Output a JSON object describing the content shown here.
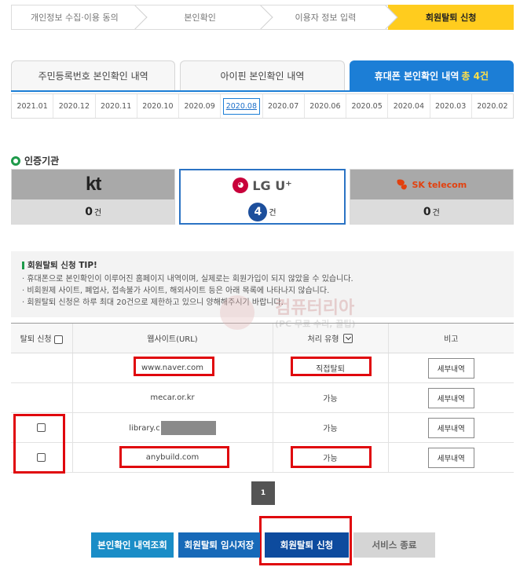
{
  "steps": [
    "개인정보 수집·이용 동의",
    "본인확인",
    "이용자 정보 입력",
    "회원탈퇴 신청"
  ],
  "tabs": [
    {
      "label": "주민등록번호 본인확인 내역",
      "count": ""
    },
    {
      "label": "아이핀 본인확인 내역",
      "count": ""
    },
    {
      "label": "휴대폰 본인확인 내역",
      "count": "총 4건"
    }
  ],
  "months": [
    "2021.01",
    "2020.12",
    "2020.11",
    "2020.10",
    "2020.09",
    "2020.08",
    "2020.07",
    "2020.06",
    "2020.05",
    "2020.04",
    "2020.03",
    "2020.02"
  ],
  "active_month": "2020.08",
  "agency": {
    "title": "인증기관",
    "carriers": [
      {
        "logo": "kt",
        "count": "0",
        "unit": "건"
      },
      {
        "logo": "LG U⁺",
        "count": "4",
        "unit": "건"
      },
      {
        "logo": "SK telecom",
        "count": "0",
        "unit": "건"
      }
    ]
  },
  "tip": {
    "title": "회원탈퇴 신청 TIP!",
    "lines": [
      "· 휴대폰으로 본인확인이 이루어진 홈페이지 내역이며, 실제로는 회원가입이 되지 않았을 수 있습니다.",
      "· 비회원제 사이트, 폐업사, 접속불가 사이트, 해외사이트 등은 아래 목록에 나타나지 않습니다.",
      "· 회원탈퇴 신청은 하루 최대 20건으로 제한하고 있으니 양해해주시기 바랍니다."
    ]
  },
  "watermark": {
    "main": "컴퓨터리아",
    "sub": "(PC 무료 수리, 꿀팁)"
  },
  "table": {
    "headers": [
      "탈퇴 신청",
      "웹사이트(URL)",
      "처리 유형",
      "비고"
    ],
    "rows": [
      {
        "checkbox": false,
        "url": "www.naver.com",
        "type": "직접탈퇴",
        "note": "세부내역"
      },
      {
        "checkbox": false,
        "url": "mecar.or.kr",
        "type": "가능",
        "note": "세부내역"
      },
      {
        "checkbox": true,
        "url": "library.c",
        "type": "가능",
        "note": "세부내역"
      },
      {
        "checkbox": true,
        "url": "anybuild.com",
        "type": "가능",
        "note": "세부내역"
      }
    ]
  },
  "pagination": {
    "current": "1"
  },
  "buttons": [
    "본인확인 내역조회",
    "회원탈퇴 임시저장",
    "회원탈퇴 신청",
    "서비스 종료"
  ],
  "colors": {
    "accent": "#1c7ed6",
    "highlight": "#e0070d",
    "step_active": "#ffcc1e"
  }
}
